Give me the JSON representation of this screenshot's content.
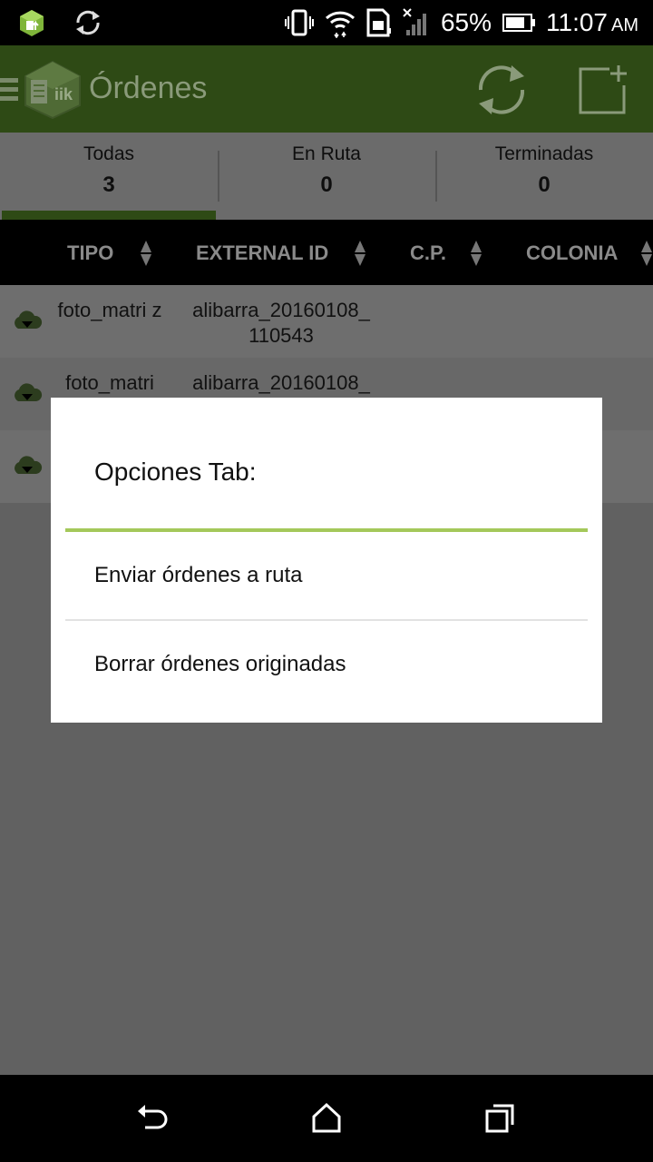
{
  "status_bar": {
    "battery": "65%",
    "time": "11:07",
    "ampm": "AM",
    "icons": [
      "app-notification-icon",
      "sync-icon",
      "vibrate-icon",
      "wifi-icon",
      "sim-icon",
      "no-signal-icon",
      "battery-icon"
    ]
  },
  "app_bar": {
    "title": "Órdenes",
    "icons": [
      "menu-icon",
      "app-logo",
      "refresh-icon",
      "new-order-icon"
    ]
  },
  "tabs": [
    {
      "label": "Todas",
      "count": "3"
    },
    {
      "label": "En Ruta",
      "count": "0"
    },
    {
      "label": "Terminadas",
      "count": "0"
    }
  ],
  "table": {
    "columns": [
      "TIPO",
      "EXTERNAL ID",
      "C.P.",
      "COLONIA"
    ],
    "rows": [
      {
        "tipo": "foto_matri z",
        "external_id": "alibarra_20160108_ 110543"
      },
      {
        "tipo": "foto_matri",
        "external_id": "alibarra_20160108_"
      }
    ]
  },
  "dialog": {
    "title": "Opciones Tab:",
    "items": [
      "Enviar órdenes a ruta",
      "Borrar órdenes originadas"
    ]
  },
  "colors": {
    "app_bar": "#2e4a15",
    "accent": "#a4c85a",
    "scrim": "#616161"
  }
}
